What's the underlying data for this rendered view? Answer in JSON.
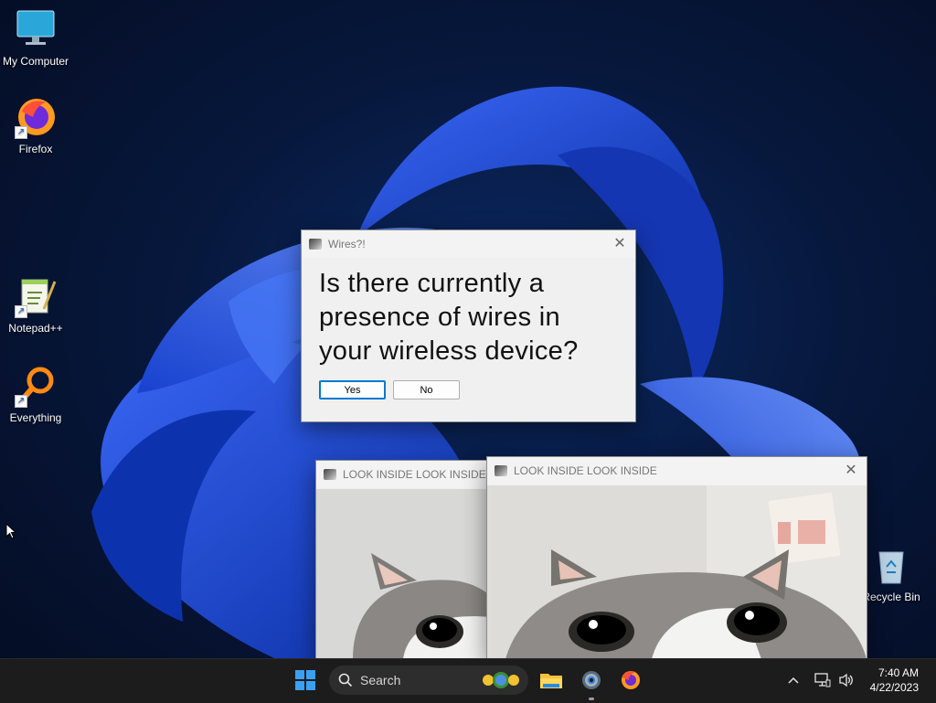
{
  "desktop": {
    "icons": [
      {
        "label": "My Computer",
        "icon": "monitor-icon"
      },
      {
        "label": "Firefox",
        "icon": "firefox-icon"
      },
      {
        "label": "Notepad++",
        "icon": "notepadpp-icon"
      },
      {
        "label": "Everything",
        "icon": "everything-icon"
      },
      {
        "label": "Recycle Bin",
        "icon": "recycle-bin-icon"
      }
    ]
  },
  "dialog": {
    "title": "Wires?!",
    "question": "Is there currently a presence of wires in your wireless device?",
    "yes_label": "Yes",
    "no_label": "No"
  },
  "cat_windows": [
    {
      "title": "LOOK INSIDE LOOK INSIDE"
    },
    {
      "title": "LOOK INSIDE LOOK INSIDE"
    }
  ],
  "taskbar": {
    "search_placeholder": "Search",
    "time": "7:40 AM",
    "date": "4/22/2023",
    "pinned": [
      "windows-start-icon",
      "search-icon",
      "file-explorer-icon",
      "settings-icon",
      "firefox-icon"
    ],
    "tray": [
      "chevron-up-icon",
      "network-icon",
      "volume-icon"
    ]
  },
  "colors": {
    "accent": "#0078d4",
    "taskbar": "#1c1c1c",
    "bloom": "#1f4fe6"
  }
}
